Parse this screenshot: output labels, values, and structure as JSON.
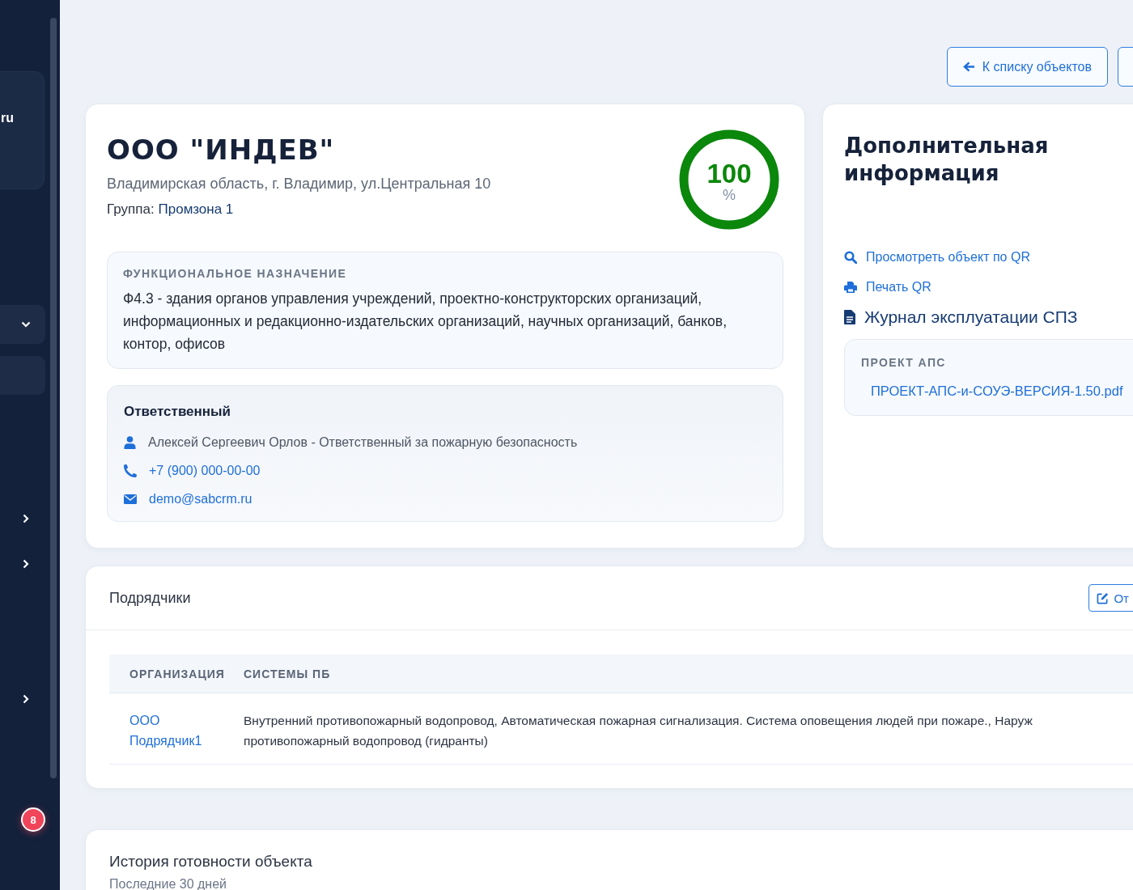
{
  "sidebar": {
    "user_card": {
      "text": "ru"
    },
    "items": [
      {
        "kind": "dropdown"
      },
      {
        "kind": "panel"
      },
      {
        "kind": "submenu"
      },
      {
        "kind": "submenu"
      },
      {
        "kind": "submenu"
      }
    ],
    "badge": "8"
  },
  "toolbar": {
    "buttons": [
      {
        "label": "К списку объектов",
        "kind": "back"
      },
      {
        "kind": "blank"
      }
    ]
  },
  "object": {
    "title": "ООО \"ИНДЕВ\"",
    "address": "Владимирская область, г. Владимир, ул.Центральная 10",
    "group_label": "Группа:",
    "group": "Промзона 1",
    "readiness": {
      "value": "100",
      "unit": "%",
      "level": 1,
      "color": "#0b870b"
    },
    "purpose": {
      "heading": "ФУНКЦИОНАЛЬНОЕ НАЗНАЧЕНИЕ",
      "text": "Ф4.3 - здания органов управления учреждений, проектно-конструкторских организаций, информационных и редакционно-издательских организаций, научных организаций, банков, контор, офисов"
    },
    "responsible": {
      "heading": "Ответственный",
      "contacts": [
        {
          "kind": "person",
          "text": "Алексей Сергеевич Орлов - Ответственный за пожарную безопасность"
        },
        {
          "kind": "phone",
          "text": "+7 (900) 000-00-00"
        },
        {
          "kind": "email",
          "text": "demo@sabcrm.ru"
        }
      ]
    }
  },
  "additional": {
    "title": "Дополнительная информация",
    "links": [
      {
        "kind": "search",
        "label": "Просмотреть объект по QR"
      },
      {
        "kind": "print",
        "label": "Печать QR"
      },
      {
        "kind": "document",
        "label": "Журнал эксплуатации СПЗ"
      }
    ],
    "project": {
      "heading": "ПРОЕКТ АПС",
      "file": "ПРОЕКТ-АПС-и-СОУЭ-ВЕРСИЯ-1.50.pdf"
    }
  },
  "contractors": {
    "title": "Подрядчики",
    "button": "От",
    "columns": [
      "ОРГАНИЗАЦИЯ",
      "СИСТЕМЫ ПБ"
    ],
    "rows": [
      {
        "organization": "ООО Подрядчик1",
        "systems_lines": [
          "Внутренний противопожарный водопровод, Автоматическая пожарная сигнализация. Система оповещения людей при пожаре., Наруж",
          "противопожарный водопровод (гидранты)"
        ]
      }
    ]
  },
  "history": {
    "title": "История готовности объекта",
    "subtitle": "Последние 30 дней"
  }
}
